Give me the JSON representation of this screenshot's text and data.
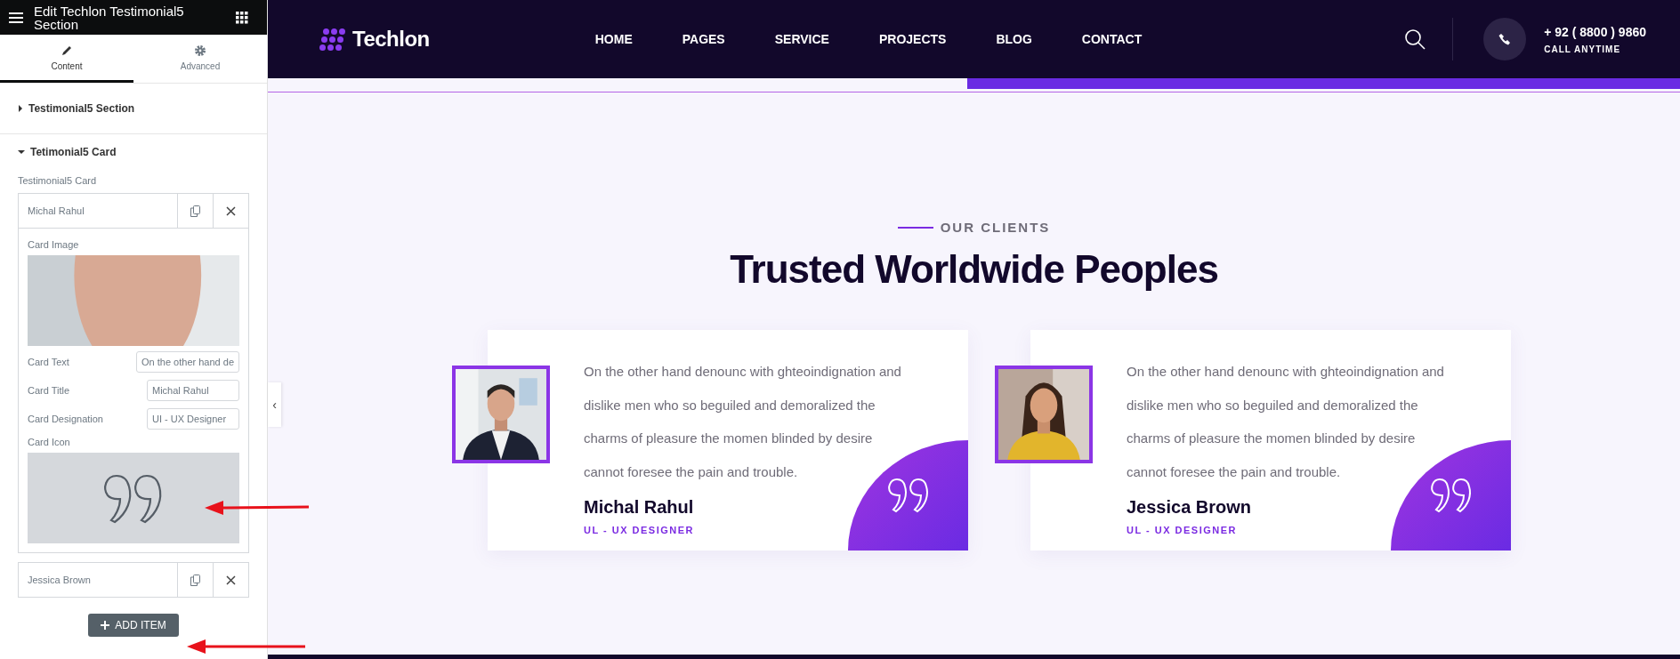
{
  "editor": {
    "title": "Edit Techlon Testimonial5 Section",
    "tabs": [
      {
        "label": "Content",
        "kind": "pencil",
        "selected": true
      },
      {
        "label": "Advanced",
        "kind": "gear",
        "selected": false
      }
    ],
    "sections": [
      {
        "label": "Testimonial5 Section",
        "expanded": false
      },
      {
        "label": "Tetimonial5 Card",
        "expanded": true
      }
    ],
    "repeater_label": "Testimonial5 Card",
    "items": [
      {
        "title": "Michal Rahul",
        "fields": [
          {
            "label": "Card Image"
          },
          {
            "kind": "text",
            "label": "Card Text",
            "value": "On the other hand de"
          },
          {
            "kind": "text",
            "label": "Card Title",
            "value": "Michal Rahul"
          },
          {
            "kind": "text",
            "label": "Card Designation",
            "value": "UI - UX Designer"
          },
          {
            "kind": "icon",
            "label": "Card Icon"
          }
        ]
      },
      {
        "title": "Jessica Brown"
      }
    ],
    "add_button": "ADD ITEM",
    "collapse_handle": "‹"
  },
  "site": {
    "logo": "Techlon",
    "nav": [
      "HOME",
      "PAGES",
      "SERVICE",
      "PROJECTS",
      "BLOG",
      "CONTACT"
    ],
    "phone": "+ 92 ( 8800 ) 9860",
    "phone_caption": "CALL ANYTIME",
    "eyebrow": "OUR CLIENTS",
    "title": "Trusted Worldwide Peoples",
    "cards": [
      {
        "text": "On the other hand denounc with ghteoindignation and dislike men who so beguiled and demoralized the charms of pleasure the momen blinded by desire cannot foresee the pain and trouble.",
        "name": "Michal Rahul",
        "designation": "UL - UX DESIGNER"
      },
      {
        "text": "On the other hand denounc with ghteoindignation and dislike men who so beguiled and demoralized the charms of pleasure the momen blinded by desire cannot foresee the pain and trouble.",
        "name": "Jessica Brown",
        "designation": "UL - UX DESIGNER"
      }
    ]
  }
}
